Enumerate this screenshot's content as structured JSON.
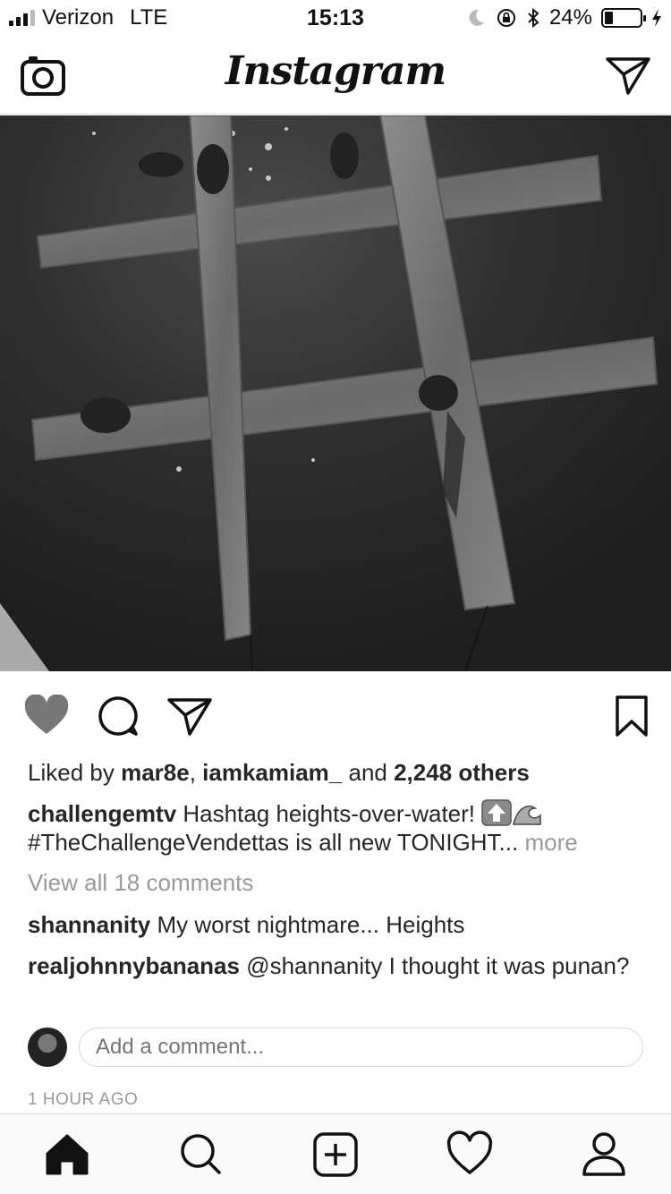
{
  "status_bar": {
    "carrier": "Verizon",
    "network": "LTE",
    "time": "15:13",
    "battery": "24%",
    "battery_level": 0.24
  },
  "nav": {
    "title": "Instagram",
    "icons": [
      "camera-icon",
      "direct-send-icon"
    ]
  },
  "post": {
    "liked_by_prefix": "Liked by ",
    "liked_users": [
      "mar8e",
      "iamkamiam_"
    ],
    "liked_sep": ", ",
    "liked_and": " and ",
    "liked_others": "2,248 others",
    "caption_user": "challengemtv",
    "caption_text": "Hashtag heights-over-water!",
    "caption_line2": "#TheChallengeVendettas is all new TONIGHT...",
    "more_label": "more",
    "caption_emojis": [
      "up-arrow-emoji",
      "wave-emoji"
    ],
    "view_all_comments": "View all 18 comments",
    "comments": [
      {
        "user": "shannanity",
        "text": "My worst nightmare... Heights"
      },
      {
        "user": "realjohnnybananas",
        "text": "@shannanity I thought it was punan?"
      }
    ],
    "add_comment_placeholder": "Add a comment...",
    "timestamp": "1 HOUR AGO"
  },
  "tab_bar": {
    "items": [
      "home-icon",
      "search-icon",
      "new-post-icon",
      "activity-icon",
      "profile-icon"
    ]
  }
}
